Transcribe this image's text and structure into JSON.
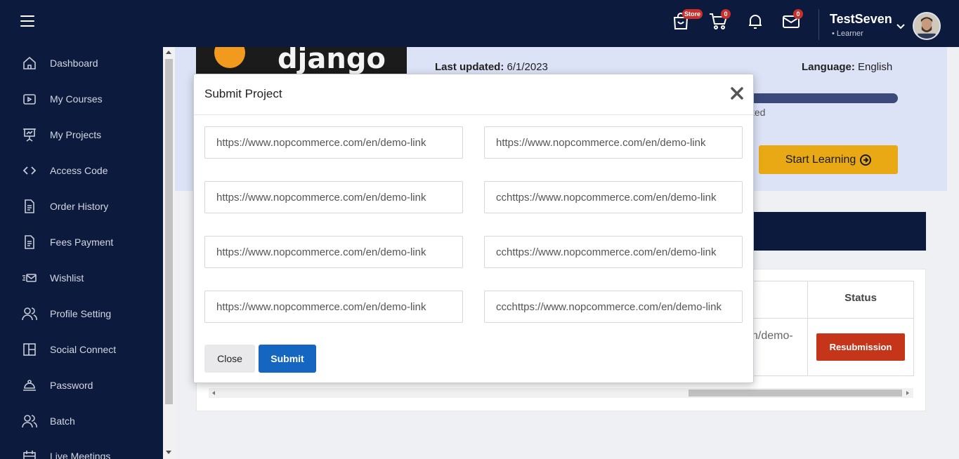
{
  "header": {
    "store_label": "Store",
    "cart_count": "0",
    "mail_count": "0",
    "user_name": "TestSeven",
    "user_role": "• Learner"
  },
  "sidebar": {
    "items": [
      {
        "label": "Dashboard",
        "icon": "home-icon"
      },
      {
        "label": "My Courses",
        "icon": "play-icon"
      },
      {
        "label": "My Projects",
        "icon": "presentation-icon"
      },
      {
        "label": "Access Code",
        "icon": "code-icon"
      },
      {
        "label": "Order History",
        "icon": "document-icon"
      },
      {
        "label": "Fees Payment",
        "icon": "document-icon"
      },
      {
        "label": "Wishlist",
        "icon": "mail-icon"
      },
      {
        "label": "Profile Setting",
        "icon": "users-icon"
      },
      {
        "label": "Social Connect",
        "icon": "layout-icon"
      },
      {
        "label": "Password",
        "icon": "lock-icon"
      },
      {
        "label": "Batch",
        "icon": "users-icon"
      },
      {
        "label": "Live Meetings",
        "icon": "calendar-icon"
      }
    ]
  },
  "course": {
    "thumb_text": "django",
    "last_updated_label": "Last updated:",
    "last_updated_value": "6/1/2023",
    "language_label": "Language:",
    "language_value": "English",
    "progress_text_partial": "ted",
    "start_button": "Start Learning"
  },
  "table": {
    "status_header": "Status",
    "cell_partial": "n/demo-",
    "resubmission_button": "Resubmission"
  },
  "modal": {
    "title": "Submit Project",
    "links": [
      "https://www.nopcommerce.com/en/demo-link",
      "https://www.nopcommerce.com/en/demo-link",
      "https://www.nopcommerce.com/en/demo-link",
      "cchttps://www.nopcommerce.com/en/demo-link",
      "https://www.nopcommerce.com/en/demo-link",
      "cchttps://www.nopcommerce.com/en/demo-link",
      "https://www.nopcommerce.com/en/demo-link",
      "ccchttps://www.nopcommerce.com/en/demo-link"
    ],
    "close_button": "Close",
    "submit_button": "Submit"
  },
  "colors": {
    "navy": "#0c1a3e",
    "accent_yellow": "#e8a914",
    "submit_blue": "#1566c0",
    "resubmit_red": "#c53519"
  }
}
